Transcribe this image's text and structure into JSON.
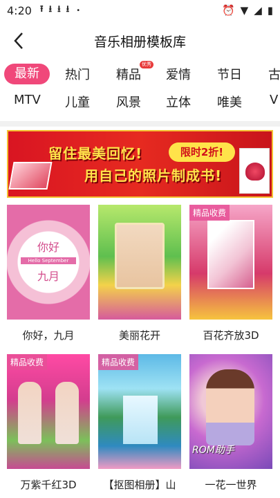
{
  "status_bar": {
    "time": "4:20",
    "download_icons": [
      "upload-icon",
      "download-icon",
      "download-icon",
      "download-icon"
    ],
    "dot": "•",
    "right_icons": [
      "alarm-icon",
      "wifi-icon",
      "signal-icon",
      "battery-icon"
    ]
  },
  "header": {
    "title": "音乐相册模板库",
    "back_icon": "back-arrow-icon"
  },
  "tabs_row1": [
    {
      "label": "最新",
      "active": true
    },
    {
      "label": "热门"
    },
    {
      "label": "精品",
      "badge": "优秀"
    },
    {
      "label": "爱情"
    },
    {
      "label": "节日"
    },
    {
      "label": "古"
    }
  ],
  "tabs_row2": [
    {
      "label": "MTV"
    },
    {
      "label": "儿童"
    },
    {
      "label": "风景"
    },
    {
      "label": "立体"
    },
    {
      "label": "唯美"
    },
    {
      "label": "V"
    }
  ],
  "banner": {
    "line1": "留住最美回忆!",
    "line2": "用自己的照片制成书!",
    "promo": "限时2折!",
    "colors": {
      "bg": "#d91522",
      "text": "#ffe34a"
    }
  },
  "cards": [
    {
      "caption": "你好，九月",
      "paid": "",
      "overlay_hello": "你好",
      "overlay_sub": "Hello September",
      "overlay_month": "九月"
    },
    {
      "caption": "美丽花开",
      "paid": ""
    },
    {
      "caption": "百花齐放3D",
      "paid": "精品收费"
    },
    {
      "caption": "万紫千红3D",
      "paid": "精品收费"
    },
    {
      "caption": "【抠图相册】山",
      "paid": "精品收费"
    },
    {
      "caption": "一花一世界",
      "paid": "",
      "watermark": "ROM助手"
    }
  ],
  "colors": {
    "accent": "#f0487a"
  }
}
